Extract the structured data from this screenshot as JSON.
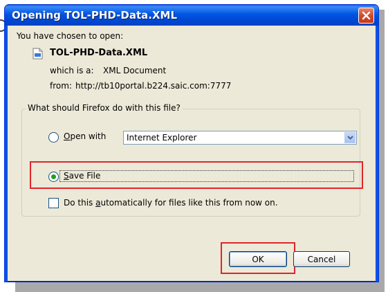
{
  "window": {
    "title": "Opening TOL-PHD-Data.XML"
  },
  "info": {
    "intro": "You have chosen to open:",
    "file_name": "TOL-PHD-Data.XML",
    "which_is_label": "which is a:",
    "which_is_value": "XML Document",
    "from_label": "from:",
    "from_value": "http://tb10portal.b224.saic.com:7777"
  },
  "group": {
    "legend": "What should Firefox do with this file?",
    "open_with": {
      "prefix": "",
      "access_key": "O",
      "rest": "pen with",
      "selected": false
    },
    "app_select": {
      "value": "Internet Explorer"
    },
    "save_file": {
      "access_key": "S",
      "rest": "ave File",
      "selected": true
    },
    "auto": {
      "prefix": "Do this ",
      "access_key": "a",
      "rest": "utomatically for files like this from now on.",
      "checked": false
    }
  },
  "buttons": {
    "ok": "OK",
    "cancel": "Cancel"
  },
  "colors": {
    "title_bar": "#0055e5",
    "highlight": "#e0242a",
    "dialog_bg": "#ece9d8"
  }
}
